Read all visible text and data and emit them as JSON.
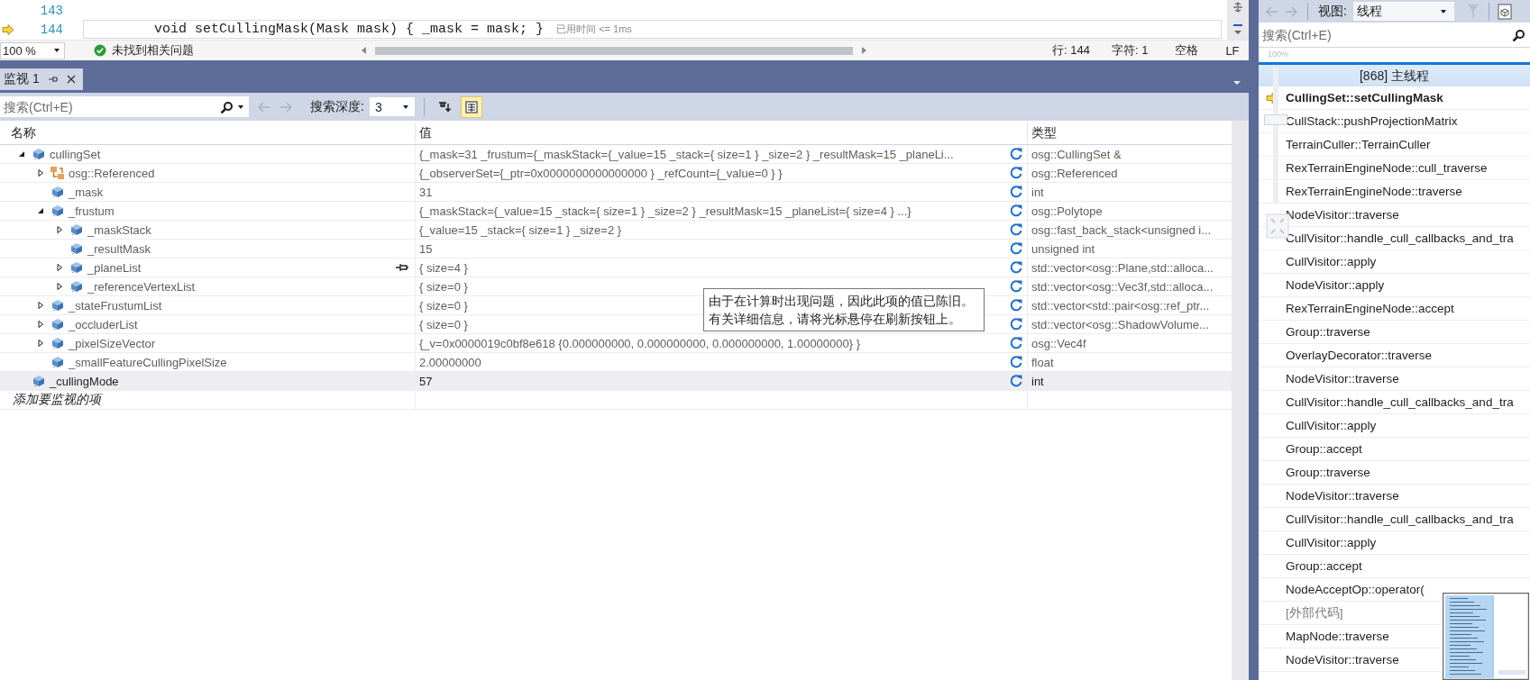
{
  "editor": {
    "lines": [
      {
        "number": "143",
        "current": false
      },
      {
        "number": "144",
        "code": "void setCullingMask(Mask mask) { _mask = mask; }",
        "perf_tip": "已用时间 <= 1ms",
        "current": true
      }
    ]
  },
  "status_bar": {
    "zoom": "100 %",
    "issues": "未找到相关问题",
    "line": "行: 144",
    "column": "字符: 1",
    "indent": "空格",
    "line_ending": "LF"
  },
  "watch": {
    "tab": {
      "title": "监视 1"
    },
    "search": {
      "placeholder": "搜索(Ctrl+E)"
    },
    "search_depth_label": "搜索深度:",
    "search_depth": "3",
    "tools": [
      {
        "kind": "pin",
        "selected": false
      },
      {
        "kind": "hex",
        "selected": true
      }
    ],
    "columns": [
      "名称",
      "值",
      "类型"
    ],
    "rows": [
      {
        "name": "cullingSet",
        "value": "{_mask=31 _frustum={_maskStack={_value=15 _stack={ size=1 } _size=2 } _resultMask=15 _planeLi...",
        "type": "osg::CullingSet &",
        "kind": "field",
        "expanded": true,
        "selected": false,
        "pinned": false,
        "stale": true,
        "children": [
          {
            "name": "osg::Referenced",
            "value": "{_observerSet={_ptr=0x0000000000000000 } _refCount={_value=0 } }",
            "type": "osg::Referenced",
            "kind": "base",
            "expanded": false,
            "selected": false,
            "pinned": false,
            "stale": true
          },
          {
            "name": "_mask",
            "value": "31",
            "type": "int",
            "kind": "field",
            "selected": false,
            "pinned": false,
            "stale": true
          },
          {
            "name": "_frustum",
            "value": "{_maskStack={_value=15 _stack={ size=1 } _size=2 } _resultMask=15 _planeList={ size=4 } ...}",
            "type": "osg::Polytope",
            "kind": "field",
            "expanded": true,
            "selected": false,
            "pinned": false,
            "stale": true,
            "children": [
              {
                "name": "_maskStack",
                "value": "{_value=15 _stack={ size=1 } _size=2 }",
                "type": "osg::fast_back_stack<unsigned i...",
                "kind": "field",
                "expanded": false,
                "selected": false,
                "pinned": false,
                "stale": true
              },
              {
                "name": "_resultMask",
                "value": "15",
                "type": "unsigned int",
                "kind": "field",
                "selected": false,
                "pinned": false,
                "stale": true
              },
              {
                "name": "_planeList",
                "value": "{ size=4 }",
                "type": "std::vector<osg::Plane,std::alloca...",
                "kind": "field",
                "expanded": false,
                "selected": false,
                "pinned": true,
                "stale": true
              },
              {
                "name": "_referenceVertexList",
                "value": "{ size=0 }",
                "type": "std::vector<osg::Vec3f,std::alloca...",
                "kind": "field",
                "expanded": false,
                "selected": false,
                "pinned": false,
                "stale": true
              }
            ]
          },
          {
            "name": "_stateFrustumList",
            "value": "{ size=0 }",
            "type": "std::vector<std::pair<osg::ref_ptr...",
            "kind": "field",
            "expanded": false,
            "selected": false,
            "pinned": false,
            "stale": true
          },
          {
            "name": "_occluderList",
            "value": "{ size=0 }",
            "type": "std::vector<osg::ShadowVolume...",
            "kind": "field",
            "expanded": false,
            "selected": false,
            "pinned": false,
            "stale": true
          },
          {
            "name": "_pixelSizeVector",
            "value": "{_v=0x0000019c0bf8e618 {0.000000000, 0.000000000, 0.000000000, 1.00000000} }",
            "type": "osg::Vec4f",
            "kind": "field",
            "expanded": false,
            "selected": false,
            "pinned": false,
            "stale": true
          },
          {
            "name": "_smallFeatureCullingPixelSize",
            "value": "2.00000000",
            "type": "float",
            "kind": "field",
            "selected": false,
            "pinned": false,
            "stale": true
          }
        ]
      },
      {
        "name": "_cullingMode",
        "value": "57",
        "type": "int",
        "kind": "field",
        "selected": true,
        "pinned": false,
        "stale": true
      }
    ],
    "add_placeholder": "添加要监视的项",
    "tooltip": "由于在计算时出现问题，因此此项的值已陈旧。有关详细信息，请将光标悬停在刷新按钮上。"
  },
  "call_stack": {
    "view_label": "视图:",
    "view": "线程",
    "search": {
      "placeholder": "搜索(Ctrl+E)"
    },
    "zoom": {
      "label": "100%",
      "level": 0.6
    },
    "thread": "[868] 主线程",
    "frames": [
      {
        "name": "CullingSet::setCullingMask",
        "current": true,
        "external": false
      },
      {
        "name": "CullStack::pushProjectionMatrix",
        "current": false,
        "external": false
      },
      {
        "name": "TerrainCuller::TerrainCuller",
        "current": false,
        "external": false
      },
      {
        "name": "RexTerrainEngineNode::cull_traverse",
        "current": false,
        "external": false
      },
      {
        "name": "RexTerrainEngineNode::traverse",
        "current": false,
        "external": false
      },
      {
        "name": "NodeVisitor::traverse",
        "current": false,
        "external": false
      },
      {
        "name": "CullVisitor::handle_cull_callbacks_and_tra",
        "current": false,
        "external": false
      },
      {
        "name": "CullVisitor::apply",
        "current": false,
        "external": false
      },
      {
        "name": "NodeVisitor::apply",
        "current": false,
        "external": false
      },
      {
        "name": "RexTerrainEngineNode::accept",
        "current": false,
        "external": false
      },
      {
        "name": "Group::traverse",
        "current": false,
        "external": false
      },
      {
        "name": "OverlayDecorator::traverse",
        "current": false,
        "external": false
      },
      {
        "name": "NodeVisitor::traverse",
        "current": false,
        "external": false
      },
      {
        "name": "CullVisitor::handle_cull_callbacks_and_tra",
        "current": false,
        "external": false
      },
      {
        "name": "CullVisitor::apply",
        "current": false,
        "external": false
      },
      {
        "name": "Group::accept",
        "current": false,
        "external": false
      },
      {
        "name": "Group::traverse",
        "current": false,
        "external": false
      },
      {
        "name": "NodeVisitor::traverse",
        "current": false,
        "external": false
      },
      {
        "name": "CullVisitor::handle_cull_callbacks_and_tra",
        "current": false,
        "external": false
      },
      {
        "name": "CullVisitor::apply",
        "current": false,
        "external": false
      },
      {
        "name": "Group::accept",
        "current": false,
        "external": false
      },
      {
        "name": "NodeAcceptOp::operator(",
        "current": false,
        "external": false
      },
      {
        "name": "[外部代码]",
        "current": false,
        "external": true
      },
      {
        "name": "MapNode::traverse",
        "current": false,
        "external": false
      },
      {
        "name": "NodeVisitor::traverse",
        "current": false,
        "external": false
      }
    ]
  }
}
